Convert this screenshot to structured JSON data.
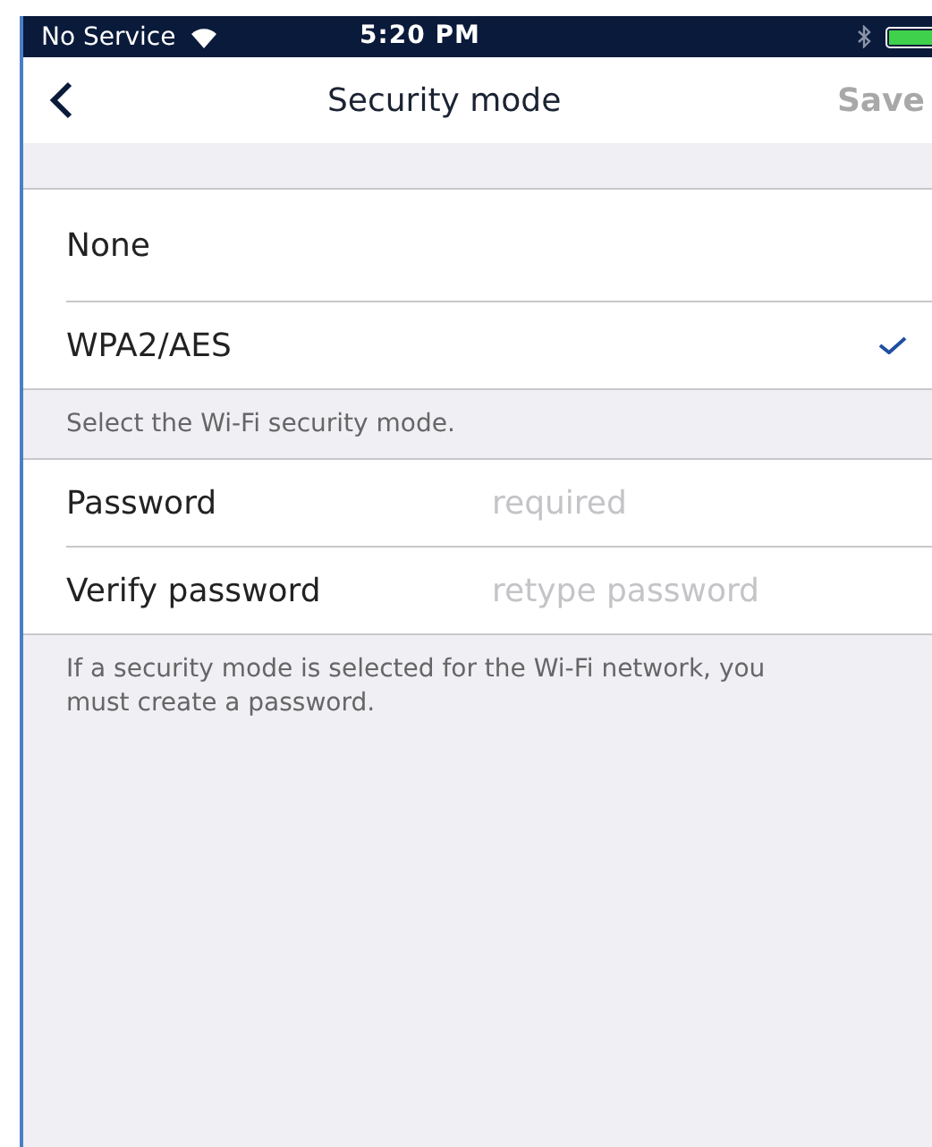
{
  "status_bar": {
    "carrier": "No Service",
    "time": "5:20 PM"
  },
  "nav": {
    "title": "Security mode",
    "save": {
      "label": "Save",
      "disabled": true
    }
  },
  "options": [
    {
      "label": "None",
      "selected": false
    },
    {
      "label": "WPA2/AES",
      "selected": true
    }
  ],
  "options_footer": "Select the Wi-Fi security mode.",
  "fields": [
    {
      "label": "Password",
      "placeholder": "required"
    },
    {
      "label": "Verify password",
      "placeholder": "retype password"
    }
  ],
  "fields_footer": "If a security mode is selected for the Wi-Fi network, you must create a password."
}
